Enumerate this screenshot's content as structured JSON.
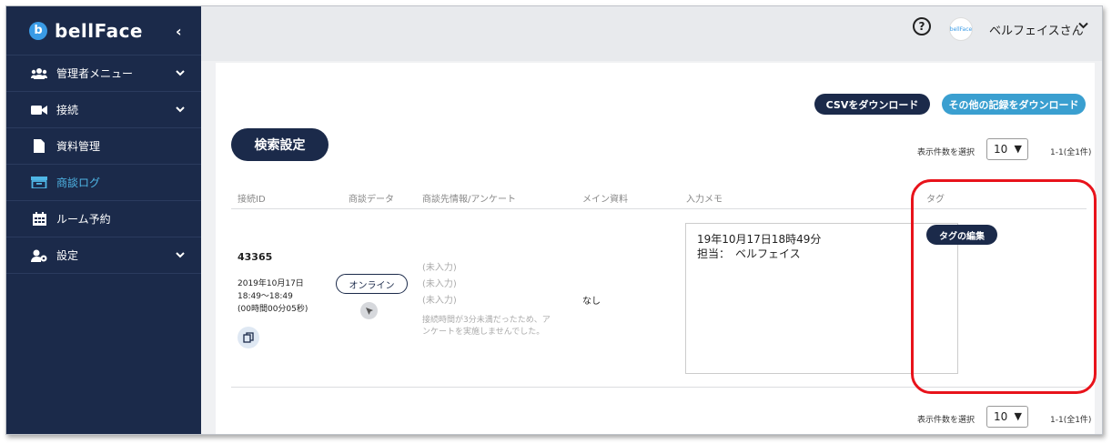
{
  "app": {
    "logo_mark": "b",
    "logo_text": "bellFace",
    "collapse": "‹"
  },
  "sidebar": {
    "items": [
      {
        "label": "管理者メニュー",
        "icon": "users-icon",
        "expandable": true
      },
      {
        "label": "接続",
        "icon": "video-camera-icon",
        "expandable": true
      },
      {
        "label": "資料管理",
        "icon": "document-icon",
        "expandable": false
      },
      {
        "label": "商談ログ",
        "icon": "archive-box-icon",
        "expandable": false,
        "active": true
      },
      {
        "label": "ルーム予約",
        "icon": "calendar-icon",
        "expandable": false
      },
      {
        "label": "設定",
        "icon": "user-gear-icon",
        "expandable": true
      }
    ]
  },
  "topbar": {
    "help": "?",
    "avatar_text": "bellFace",
    "user_name": "ベルフェイスさん",
    "chevron": "⌄"
  },
  "toolbar": {
    "csv_download": "CSVをダウンロード",
    "other_download": "その他の記録をダウンロード",
    "search_settings": "検索設定"
  },
  "pager": {
    "label": "表示件数を選択",
    "per_page": "10",
    "count": "1-1(全1件)"
  },
  "table": {
    "headers": [
      "接続ID",
      "商談データ",
      "商談先情報/アンケート",
      "メイン資料",
      "入力メモ",
      "タグ"
    ],
    "row": {
      "id": "43365",
      "date": "2019年10月17日",
      "time": "18:49〜18:49",
      "duration": "(00時間00分05秒)",
      "status": "オンライン",
      "unfilled": [
        "(未入力)",
        "(未入力)",
        "(未入力)"
      ],
      "note_line1": "接続時間が3分未満だったため、ア",
      "note_line2": "ンケートを実施しませんでした。",
      "main_material": "なし",
      "memo_line1": "19年10月17日18時49分",
      "memo_line2": "担当：　ベルフェイス",
      "tag_edit": "タグの編集"
    }
  },
  "colors": {
    "sidebar": "#1b2a4a",
    "accent": "#4fb6e6",
    "teal_button": "#3a9fd0",
    "highlight": "#e8131b"
  }
}
